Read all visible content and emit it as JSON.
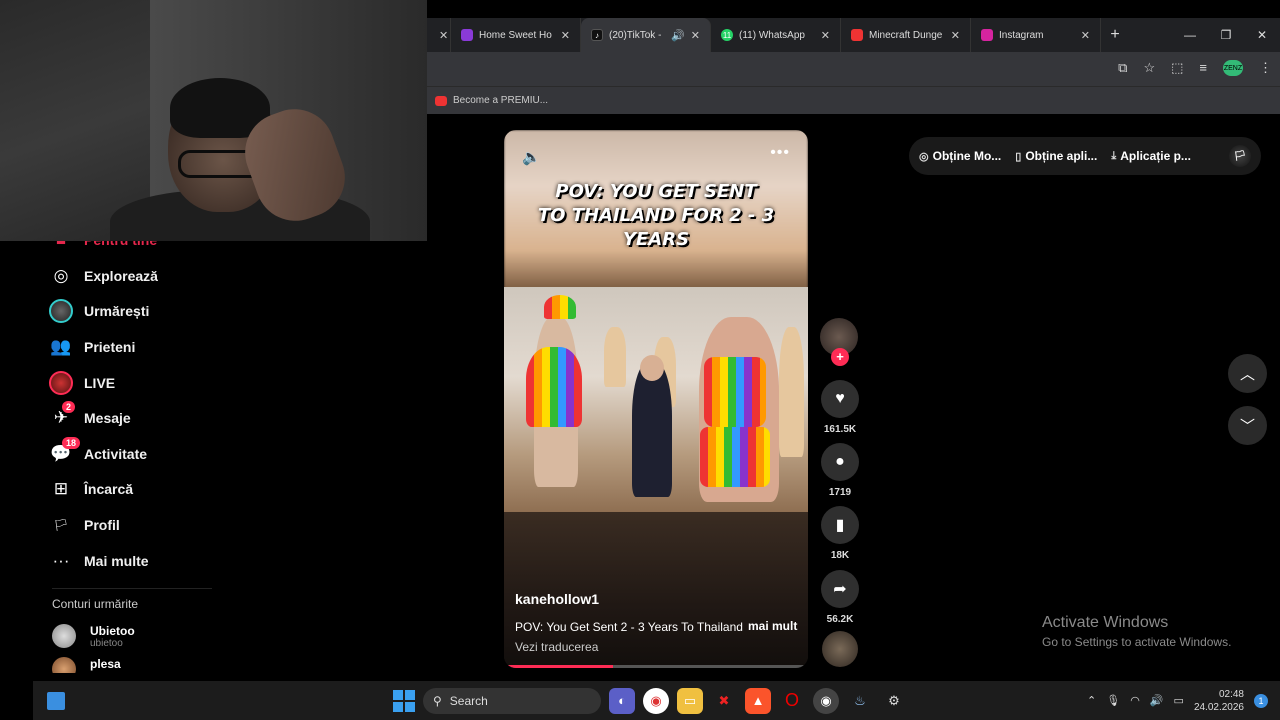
{
  "browser": {
    "tabs": [
      {
        "label": "",
        "color": "#202124"
      },
      {
        "label": "Home Sweet Ho",
        "color": "#8a3ad8"
      },
      {
        "label": "(20)TikTok - I",
        "color": "#111111"
      },
      {
        "label": "(11) WhatsApp",
        "color": "#25d366"
      },
      {
        "label": "Minecraft Dunge",
        "color": "#e33"
      },
      {
        "label": "Instagram",
        "color": "#d6249f"
      }
    ],
    "tab_close": "✕",
    "new_tab": "+",
    "win_min": "—",
    "win_max": "❐",
    "win_close": "✕",
    "ext_avatar_text": "ZENZ",
    "bookmark_label": "Become a PREMIU..."
  },
  "sidebar": {
    "partial_item": "Pentru tine",
    "items": [
      {
        "label": "Explorează",
        "icon": "compass-icon",
        "glyph": "◎"
      },
      {
        "label": "Urmărești",
        "icon": "following-avatar-icon",
        "glyph": ""
      },
      {
        "label": "Prieteni",
        "icon": "friends-icon",
        "glyph": "👥"
      },
      {
        "label": "LIVE",
        "icon": "live-icon",
        "glyph": ""
      },
      {
        "label": "Mesaje",
        "icon": "messages-icon",
        "glyph": "✈",
        "badge": "2"
      },
      {
        "label": "Activitate",
        "icon": "activity-icon",
        "glyph": "💬",
        "badge": "18"
      },
      {
        "label": "Încarcă",
        "icon": "upload-icon",
        "glyph": "⊞"
      },
      {
        "label": "Profil",
        "icon": "profile-icon",
        "glyph": "🏳"
      },
      {
        "label": "Mai multe",
        "icon": "more-icon",
        "glyph": "···"
      }
    ],
    "following_title": "Conturi urmărite",
    "following": [
      {
        "name": "Ubietoo",
        "handle": "ubietoo"
      },
      {
        "name": "plesa",
        "handle": ""
      }
    ]
  },
  "video": {
    "overlay_line1": "POV: YOU GET SENT",
    "overlay_line2": "TO THAILAND FOR 2 - 3 YEARS",
    "author": "kanehollow1",
    "description": "POV: You Get Sent 2 - 3 Years To Thailand",
    "more_label": "mai mult",
    "translate_label": "Vezi traducerea",
    "progress_fraction": 0.36
  },
  "actions": {
    "likes": "161.5K",
    "comments": "1719",
    "saves": "18K",
    "shares": "56.2K"
  },
  "top_pills": {
    "p1": "Obține Mo...",
    "p2": "Obține apli...",
    "p3": "Aplicație p..."
  },
  "watermark": {
    "line1": "Activate Windows",
    "line2": "Go to Settings to activate Windows."
  },
  "taskbar": {
    "search_label": "Search",
    "time": "02:48",
    "date": "24.02.2026",
    "notif_count": "1"
  },
  "colors": {
    "accent": "#fe2c55",
    "chrome_bg": "#202124",
    "toolbar_bg": "#35363a"
  }
}
